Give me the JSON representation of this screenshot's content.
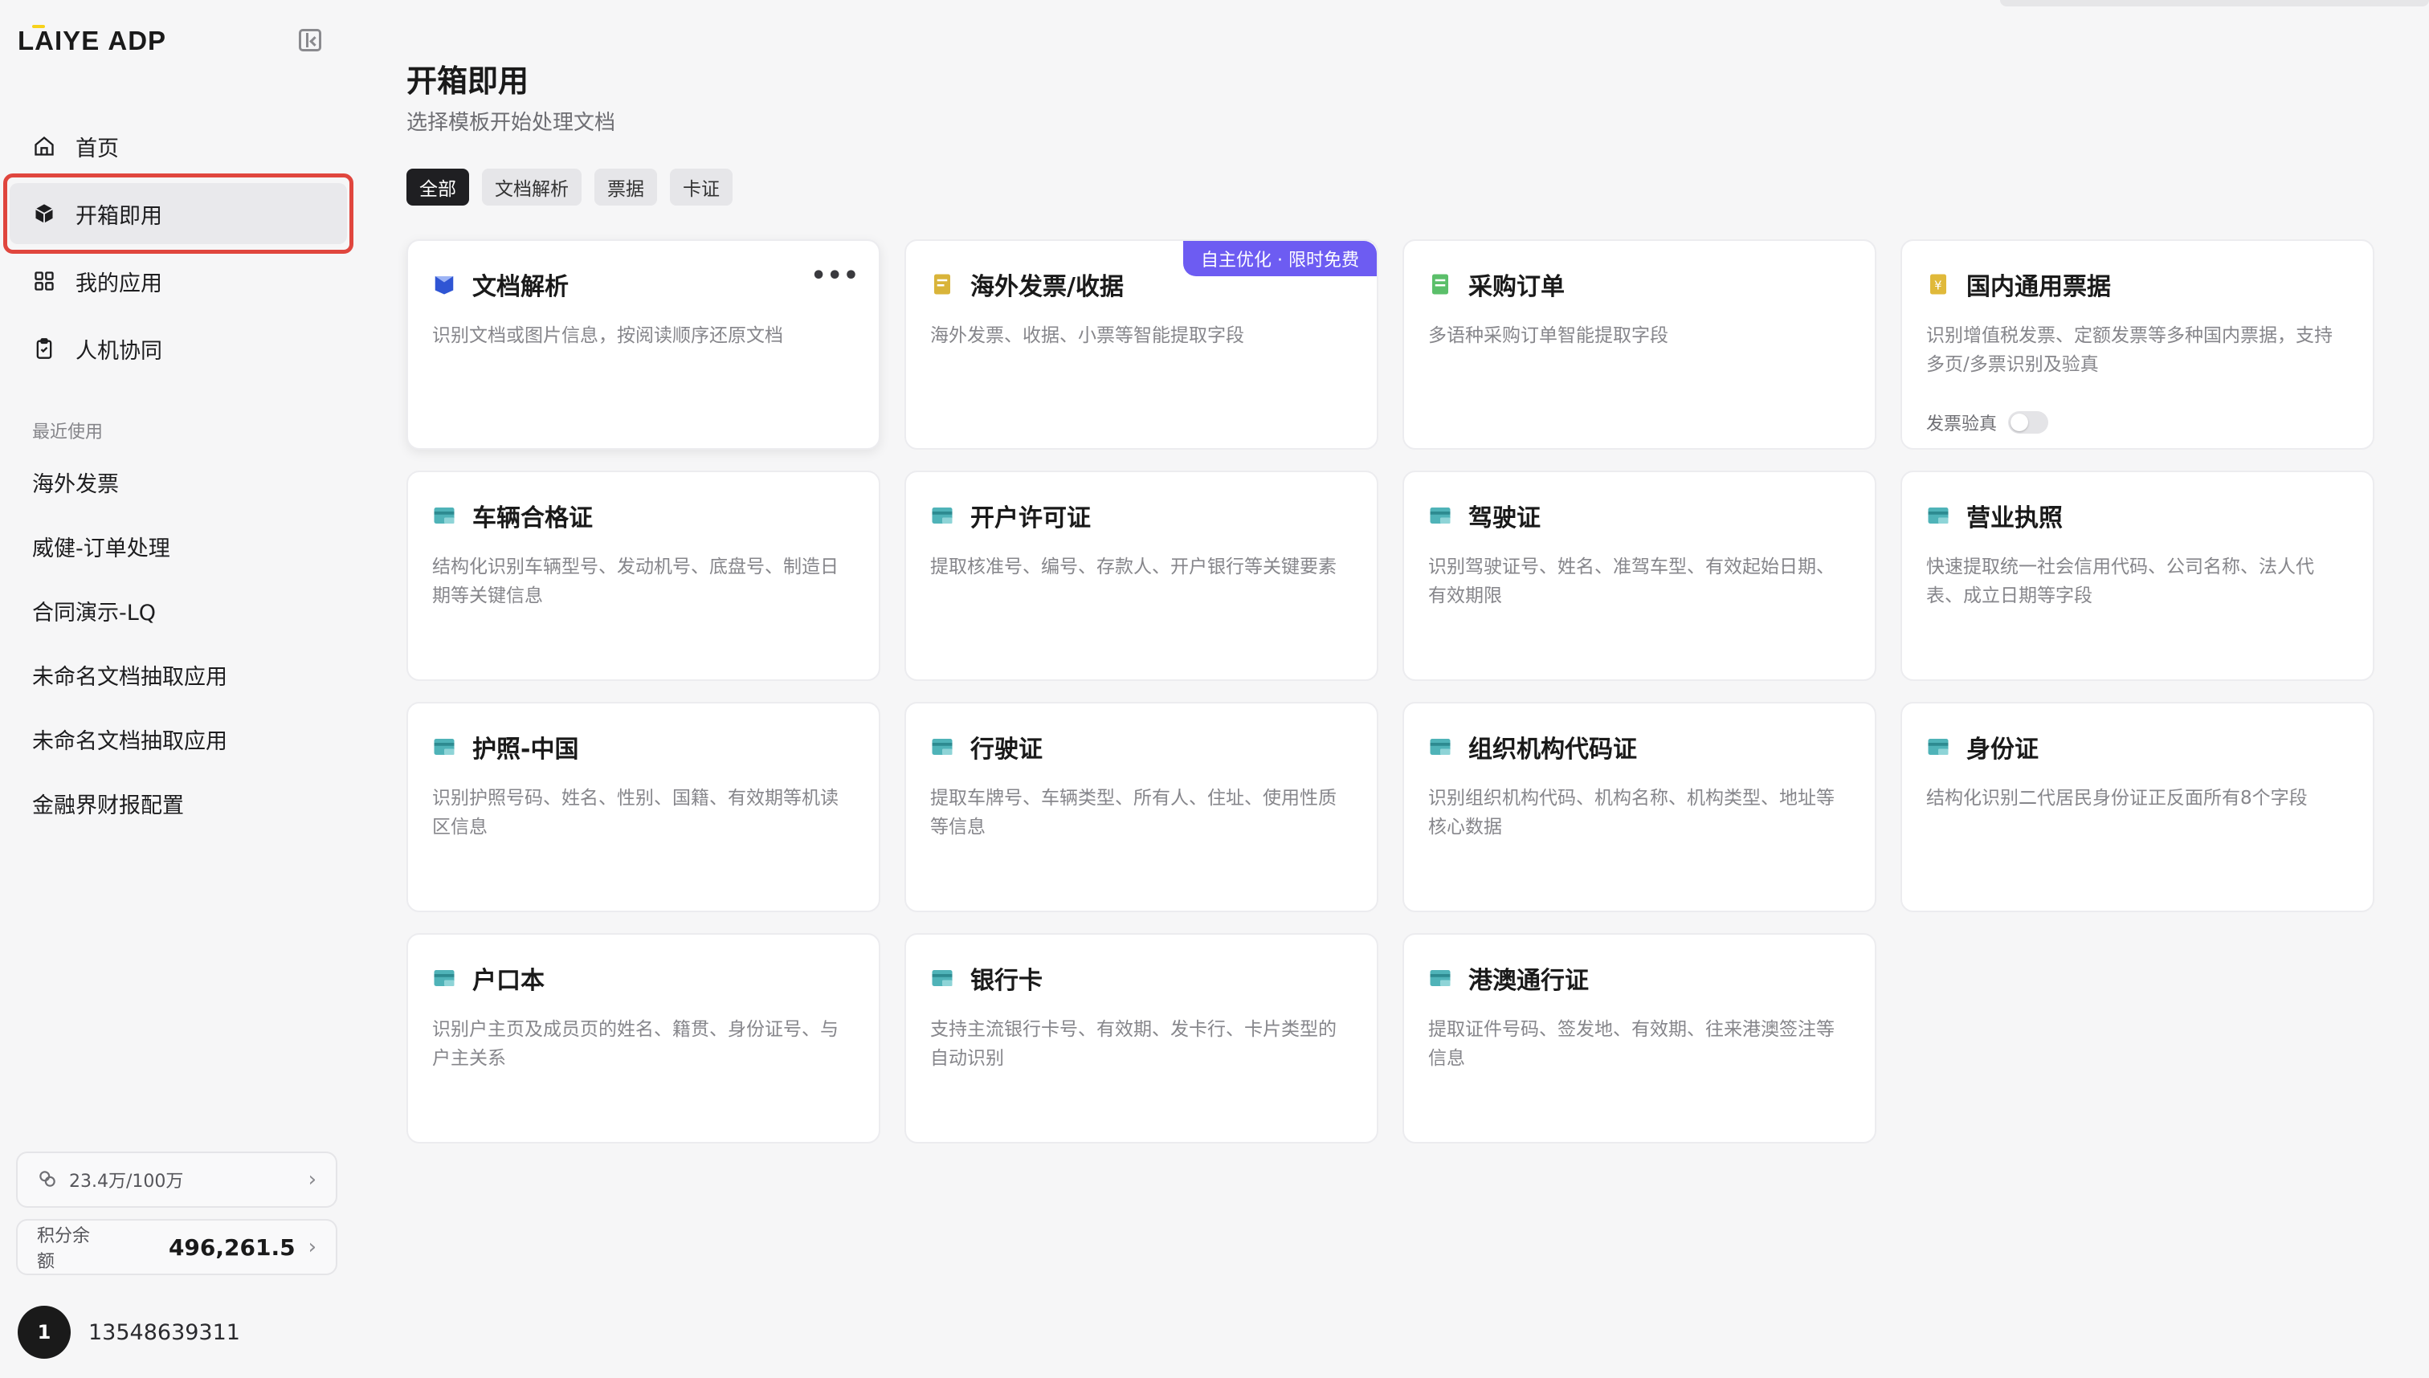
{
  "app": {
    "logo_text": "LAIYE ADP"
  },
  "sidebar": {
    "nav": [
      {
        "label": "首页",
        "icon": "home-icon"
      },
      {
        "label": "开箱即用",
        "icon": "cube-icon",
        "active": true
      },
      {
        "label": "我的应用",
        "icon": "grid-icon"
      },
      {
        "label": "人机协同",
        "icon": "clipboard-icon"
      }
    ],
    "recent_title": "最近使用",
    "recent": [
      "海外发票",
      "威健-订单处理",
      "合同演示-LQ",
      "未命名文档抽取应用",
      "未命名文档抽取应用",
      "金融界财报配置"
    ],
    "quota": "23.4万/100万",
    "credits_label": "积分余额",
    "credits_value": "496,261.5",
    "user": {
      "avatar": "1",
      "name": "13548639311"
    }
  },
  "main": {
    "title": "开箱即用",
    "subtitle": "选择模板开始处理文档",
    "filters": [
      "全部",
      "文档解析",
      "票据",
      "卡证"
    ],
    "cards": [
      {
        "title": "文档解析",
        "desc": "识别文档或图片信息，按阅读顺序还原文档",
        "icon": "document-parse-icon",
        "more": "•••"
      },
      {
        "title": "海外发票/收据",
        "desc": "海外发票、收据、小票等智能提取字段",
        "icon": "receipt-icon",
        "badge": "自主优化 · 限时免费"
      },
      {
        "title": "采购订单",
        "desc": "多语种采购订单智能提取字段",
        "icon": "order-icon"
      },
      {
        "title": "国内通用票据",
        "desc": "识别增值税发票、定额发票等多种国内票据，支持多页/多票识别及验真",
        "icon": "invoice-icon",
        "toggle_label": "发票验真"
      },
      {
        "title": "车辆合格证",
        "desc": "结构化识别车辆型号、发动机号、底盘号、制造日期等关键信息",
        "icon": "card-icon"
      },
      {
        "title": "开户许可证",
        "desc": "提取核准号、编号、存款人、开户银行等关键要素",
        "icon": "card-icon"
      },
      {
        "title": "驾驶证",
        "desc": "识别驾驶证号、姓名、准驾车型、有效起始日期、有效期限",
        "icon": "card-icon"
      },
      {
        "title": "营业执照",
        "desc": "快速提取统一社会信用代码、公司名称、法人代表、成立日期等字段",
        "icon": "card-icon"
      },
      {
        "title": "护照-中国",
        "desc": "识别护照号码、姓名、性别、国籍、有效期等机读区信息",
        "icon": "card-icon"
      },
      {
        "title": "行驶证",
        "desc": "提取车牌号、车辆类型、所有人、住址、使用性质等信息",
        "icon": "card-icon"
      },
      {
        "title": "组织机构代码证",
        "desc": "识别组织机构代码、机构名称、机构类型、地址等核心数据",
        "icon": "card-icon"
      },
      {
        "title": "身份证",
        "desc": "结构化识别二代居民身份证正反面所有8个字段",
        "icon": "card-icon"
      },
      {
        "title": "户口本",
        "desc": "识别户主页及成员页的姓名、籍贯、身份证号、与户主关系",
        "icon": "card-icon"
      },
      {
        "title": "银行卡",
        "desc": "支持主流银行卡号、有效期、发卡行、卡片类型的自动识别",
        "icon": "card-icon"
      },
      {
        "title": "港澳通行证",
        "desc": "提取证件号码、签发地、有效期、往来港澳签注等信息",
        "icon": "card-icon"
      }
    ]
  },
  "colors": {
    "accent_purple": "#6d5cf2",
    "highlight_red": "#e0463e",
    "teal_icon": "#4fb3b8"
  }
}
